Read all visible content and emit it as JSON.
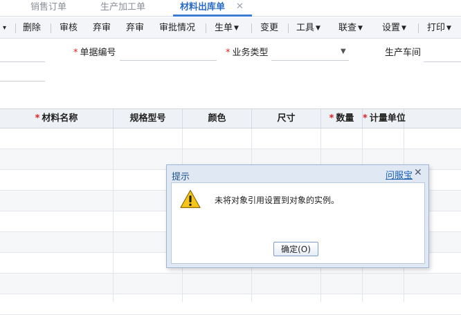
{
  "tabs": [
    {
      "label": "销售订单",
      "active": false
    },
    {
      "label": "生产加工单",
      "active": false
    },
    {
      "label": "材料出库单",
      "active": true
    }
  ],
  "tab_close_glyph": "✕",
  "toolbar": {
    "overflow_caret": "▾",
    "delete": "删除",
    "audit": "审核",
    "abandon_audit": "弃审",
    "abandon": "弃审",
    "approval_status": "审批情况",
    "generate": "生单",
    "change": "变更",
    "tools": "工具",
    "link_query": "联查",
    "settings": "设置",
    "print": "打印"
  },
  "form": {
    "doc_number_label": "单据编号",
    "business_type_label": "业务类型",
    "workshop_label": "生产车间",
    "required_mark": "*"
  },
  "grid": {
    "columns": [
      "材料名称",
      "规格型号",
      "颜色",
      "尺寸",
      "数量",
      "计量单位"
    ],
    "required_columns": [
      "材料名称",
      "数量",
      "计量单位"
    ]
  },
  "dialog": {
    "title": "提示",
    "help_link": "问服宝",
    "close_glyph": "✕",
    "message": "未将对象引用设置到对象的实例。",
    "ok_label": "确定(O)",
    "icon": "warning-icon"
  },
  "colors": {
    "accent": "#3a7bd5",
    "required": "#e02020",
    "dialog_bg": "#dfe8f3"
  }
}
